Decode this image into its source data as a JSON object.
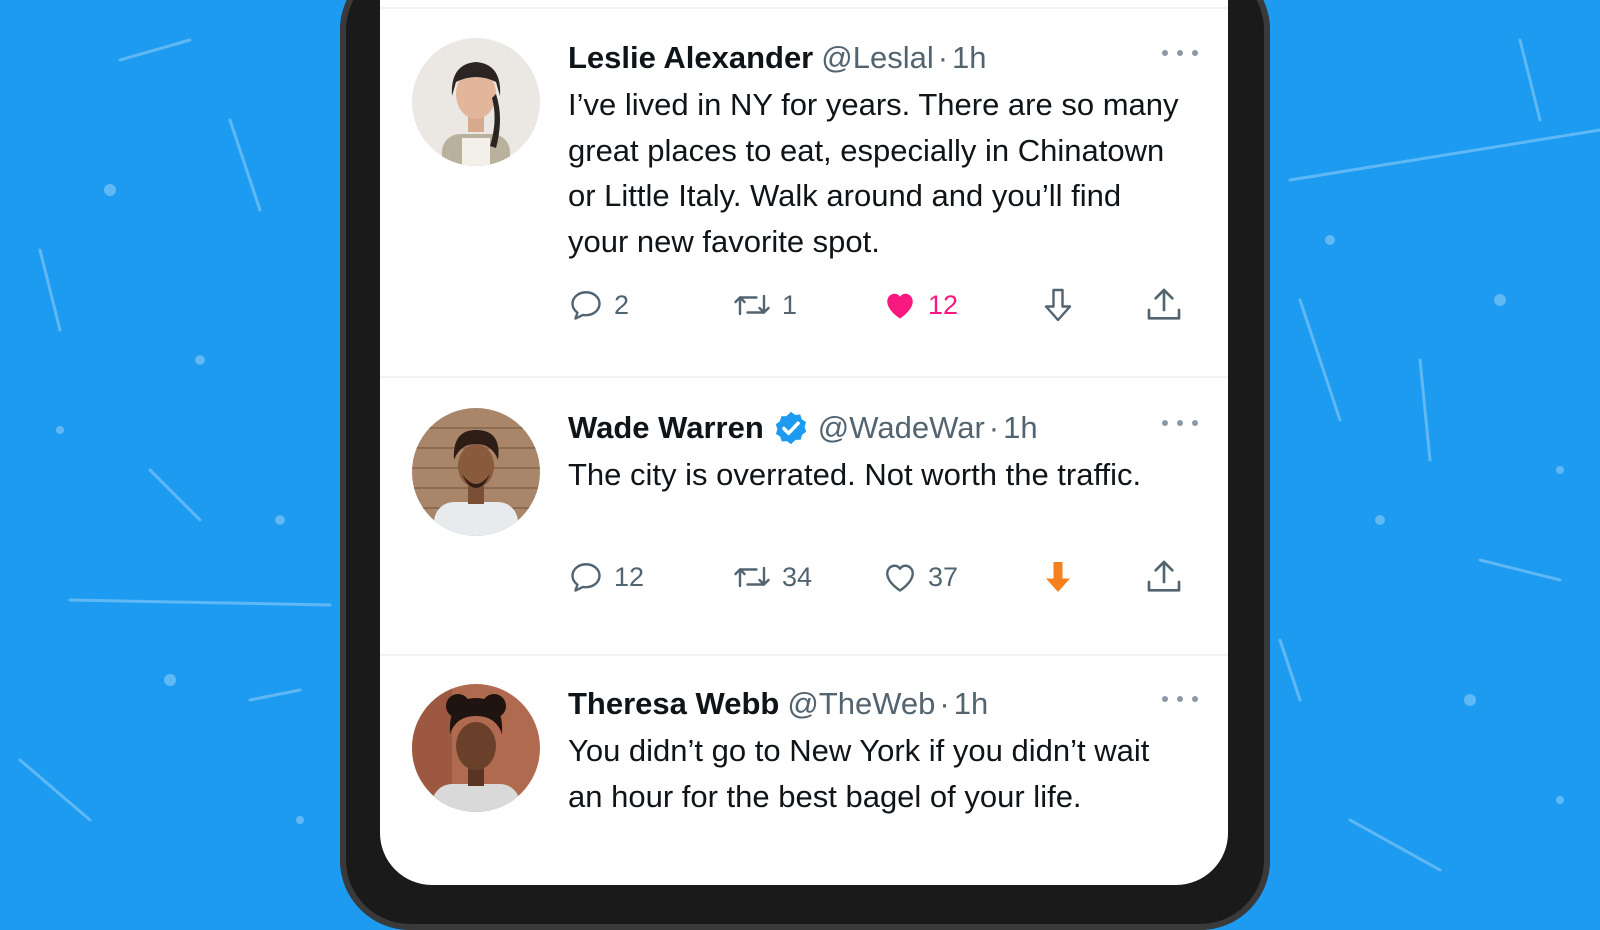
{
  "colors": {
    "background": "#1d9bf0",
    "like_active": "#f91880",
    "downvote_active": "#f4801f",
    "verified": "#1d9bf0",
    "muted_text": "#536471"
  },
  "tweets": [
    {
      "name": "Leslie Alexander",
      "handle": "@Leslal",
      "dot": "·",
      "time": "1h",
      "verified": false,
      "text": "I’ve lived in NY for years. There are so many great places to eat, especially in Chinatown or Little Italy. Walk around and you’ll find your new favorite spot.",
      "replies": "2",
      "retweets": "1",
      "likes": "12",
      "liked": true,
      "downvoted": false
    },
    {
      "name": "Wade Warren",
      "handle": "@WadeWar",
      "dot": "·",
      "time": "1h",
      "verified": true,
      "text": "The city is overrated. Not worth the traffic.",
      "replies": "12",
      "retweets": "34",
      "likes": "37",
      "liked": false,
      "downvoted": true
    },
    {
      "name": "Theresa Webb",
      "handle": "@TheWeb",
      "dot": "·",
      "time": "1h",
      "verified": false,
      "text": "You didn’t go to New York if you didn’t wait an hour for the best bagel of your life."
    }
  ]
}
